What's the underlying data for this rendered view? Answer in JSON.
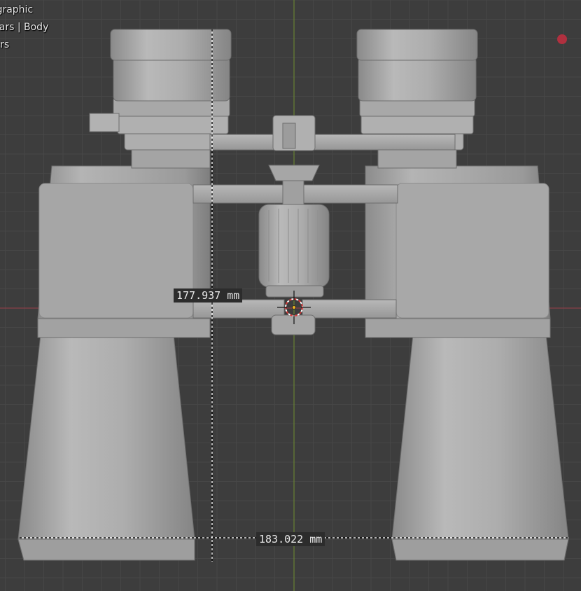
{
  "viewport": {
    "info_lines": [
      "ographic",
      "ulars | Body",
      "ters"
    ],
    "recording_color": "#b0303f"
  },
  "measurements": {
    "vertical": "177.937 mm",
    "horizontal": "183.022 mm"
  },
  "colors": {
    "background": "#3d3d3d",
    "grid": "#474747",
    "x_axis": "#9a3e49",
    "y_axis": "#6f8f2f",
    "model": "#a9a9a9",
    "cursor": "#d83a3a"
  }
}
